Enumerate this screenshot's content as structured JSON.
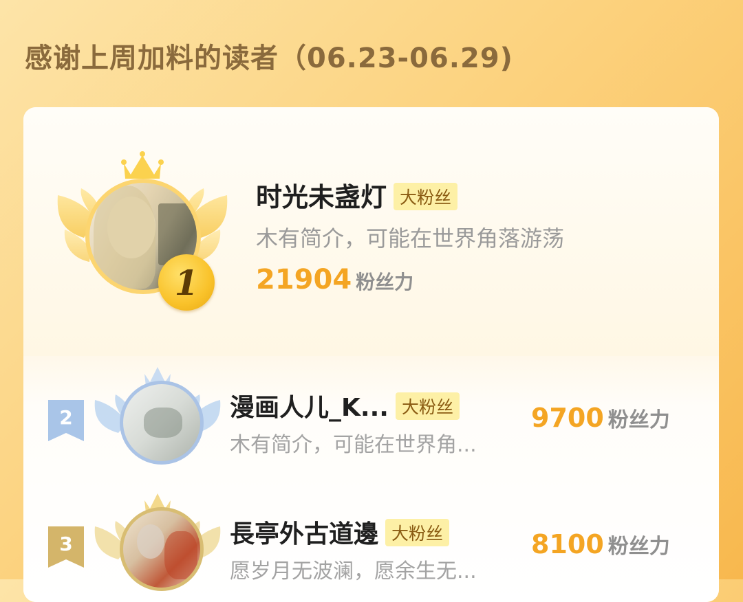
{
  "header": {
    "title": "感谢上周加料的读者（06.23-06.29)"
  },
  "colors": {
    "accent_orange": "#f4a523",
    "gold": "#f9c22a",
    "tag_bg": "#fdf0a6",
    "tag_text": "#8a5b12",
    "silver_blue": "#a9c5e8",
    "bronze": "#d4b56a"
  },
  "readers": [
    {
      "rank": "1",
      "name": "时光未盏灯",
      "tag": "大粉丝",
      "desc": "木有简介，可能在世界角落游荡",
      "score": "21904",
      "unit": "粉丝力"
    },
    {
      "rank": "2",
      "name": "漫画人儿_K...",
      "tag": "大粉丝",
      "desc": "木有简介，可能在世界角...",
      "score": "9700",
      "unit": "粉丝力"
    },
    {
      "rank": "3",
      "name": "長亭外古道邊",
      "tag": "大粉丝",
      "desc": "愿岁月无波澜，愿余生无...",
      "score": "8100",
      "unit": "粉丝力"
    }
  ],
  "icons": {
    "crown": "crown-icon",
    "wings": "wings-icon",
    "rank_flag": "rank-flag-icon"
  }
}
